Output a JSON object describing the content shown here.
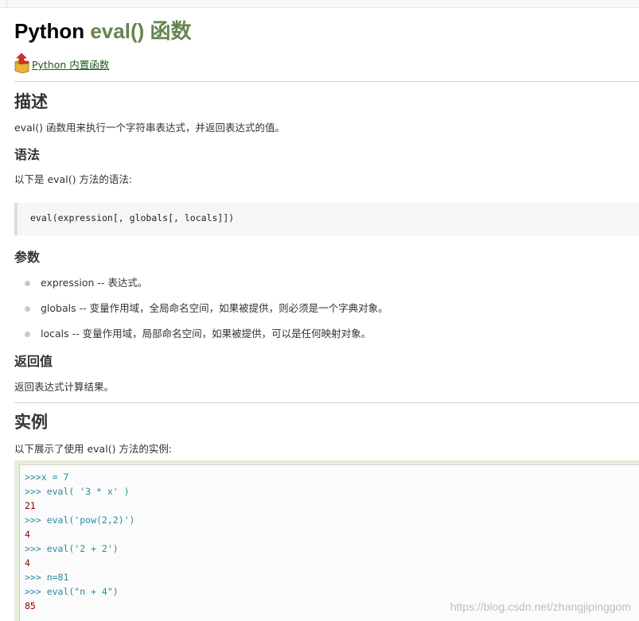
{
  "page": {
    "title_prefix": "Python ",
    "title_accent": "eval() 函数",
    "back_link_label": " Python 内置函数"
  },
  "sections": {
    "description": {
      "heading": "描述",
      "text": "eval() 函数用来执行一个字符串表达式，并返回表达式的值。"
    },
    "syntax": {
      "heading": "语法",
      "intro": "以下是 eval() 方法的语法:",
      "code": "eval(expression[, globals[, locals]])"
    },
    "params": {
      "heading": "参数",
      "items": [
        "expression -- 表达式。",
        "globals -- 变量作用域，全局命名空间，如果被提供，则必须是一个字典对象。",
        "locals -- 变量作用域，局部命名空间，如果被提供，可以是任何映射对象。"
      ]
    },
    "returns": {
      "heading": "返回值",
      "text": "返回表达式计算结果。"
    },
    "example": {
      "heading": "实例",
      "intro": "以下展示了使用 eval() 方法的实例:",
      "lines": [
        {
          "kind": "input",
          "text": ">>>x = 7"
        },
        {
          "kind": "input",
          "text": ">>> eval( '3 * x' )"
        },
        {
          "kind": "output",
          "text": "21"
        },
        {
          "kind": "input",
          "text": ">>> eval('pow(2,2)')"
        },
        {
          "kind": "output",
          "text": "4"
        },
        {
          "kind": "input",
          "text": ">>> eval('2 + 2')"
        },
        {
          "kind": "output",
          "text": "4"
        },
        {
          "kind": "input",
          "text": ">>> n=81"
        },
        {
          "kind": "input",
          "text": ">>> eval(\"n + 4\")"
        },
        {
          "kind": "output",
          "text": "85"
        }
      ]
    }
  },
  "watermark": "https://blog.csdn.net/zhangjipinggom",
  "colors": {
    "title_accent": "#64854c",
    "link": "#1a5a1a",
    "code_input": "#2a8aa0",
    "code_output": "#880000",
    "example_frame": "#e6eedb"
  },
  "icons": {
    "back_link": "up-arrow-folder-icon",
    "list_bullet": "bullet-icon"
  }
}
